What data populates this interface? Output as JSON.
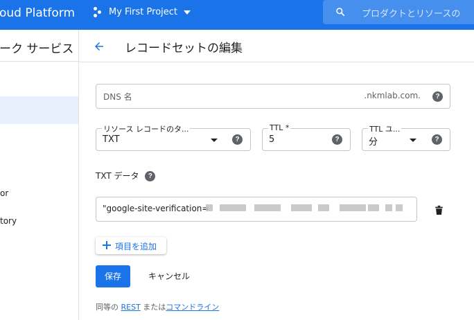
{
  "topbar": {
    "brand": "oud Platform",
    "project": "My First Project",
    "search_placeholder": "プロダクトとリソースの"
  },
  "leftnav": {
    "title": "ーク サービス",
    "items": [
      {
        "label": "or"
      },
      {
        "label": "tory"
      }
    ]
  },
  "page": {
    "title": "レコードセットの編集"
  },
  "form": {
    "dns_name_label": "DNS 名",
    "dns_suffix": ".nkmlab.com.",
    "record_type_label": "リソース レコードのタ...",
    "record_type_value": "TXT",
    "ttl_label": "TTL *",
    "ttl_value": "5",
    "ttl_unit_label": "TTL ユ...",
    "ttl_unit_value": "分",
    "txt_section_label": "TXT データ",
    "txt_value": "\"google-site-verification=",
    "add_item_label": "項目を追加",
    "save_label": "保存",
    "cancel_label": "キャンセル"
  },
  "footer": {
    "prefix": "同等の",
    "rest_link": "REST",
    "middle": "または",
    "cli_link": "コマンドライン"
  },
  "colors": {
    "topbar": "#1a73e8",
    "accent": "#1a73e8",
    "nav_selected": "#e8f0fe"
  },
  "icons": {
    "help": "?"
  }
}
